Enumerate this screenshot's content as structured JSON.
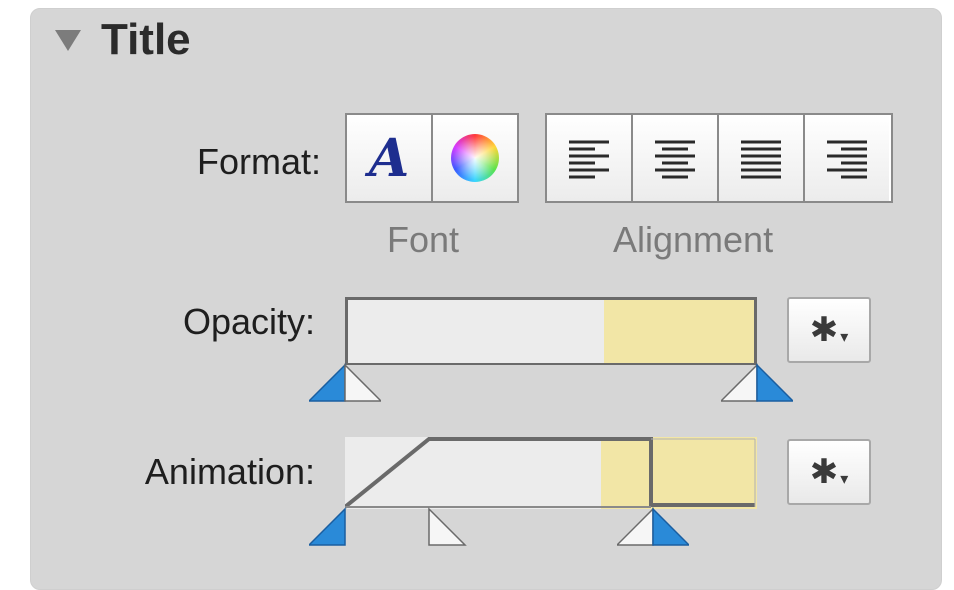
{
  "section": {
    "title": "Title",
    "disclosure_icon": "disclosure-triangle-down-icon"
  },
  "format": {
    "label": "Format:",
    "font_caption": "Font",
    "alignment_caption": "Alignment",
    "font_button_glyph": "A",
    "buttons": [
      "font-icon",
      "color-wheel-icon"
    ],
    "alignment_buttons": [
      "align-left-icon",
      "align-center-icon",
      "align-justify-icon",
      "align-right-icon"
    ]
  },
  "opacity": {
    "label": "Opacity:",
    "gear_icon": "gear-icon",
    "markers": [
      "start-marker-icon",
      "end-marker-icon"
    ]
  },
  "animation": {
    "label": "Animation:",
    "gear_icon": "gear-icon",
    "markers": [
      "start-marker-icon",
      "fade-in-end-marker-icon",
      "hold-end-marker-icon"
    ]
  },
  "colors": {
    "panel_bg": "#d6d6d6",
    "hold_highlight": "#f2e6a6",
    "marker_blue": "#2a8ad8",
    "font_glyph": "#1e2e8f"
  }
}
